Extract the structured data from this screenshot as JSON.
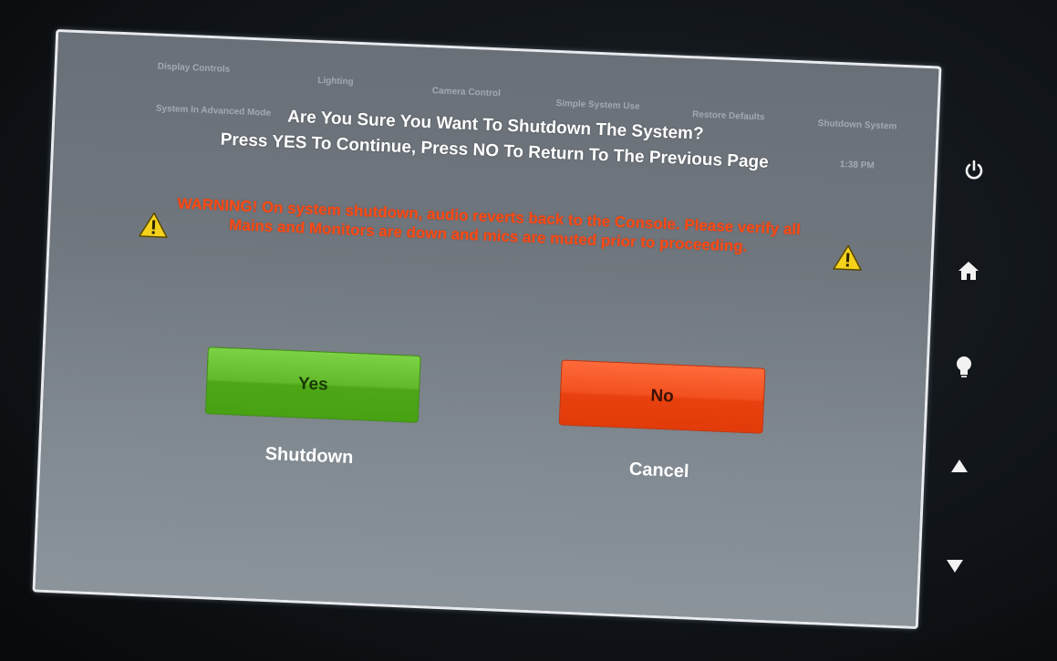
{
  "nav": {
    "display_controls": "Display Controls",
    "lighting": "Lighting",
    "camera_control": "Camera Control",
    "simple_system_use": "Simple System Use",
    "restore_defaults": "Restore Defaults",
    "shutdown_system": "Shutdown System",
    "system_advanced_mode": "System In Advanced Mode",
    "clock": "1:38 PM"
  },
  "dialog": {
    "title": "Are You Sure You Want To Shutdown The System?",
    "subtitle": "Press YES To Continue, Press NO To Return To The Previous Page",
    "warning": "WARNING!  On system shutdown, audio reverts back to the Console. Please verify all Mains and Monitors are down and mics are muted prior to proceeding.",
    "yes_label": "Yes",
    "yes_caption": "Shutdown",
    "no_label": "No",
    "no_caption": "Cancel"
  },
  "colors": {
    "yes": "#5fb626",
    "no": "#f04d1d",
    "warning_text": "#ff4a12",
    "warning_icon": "#f5d21c"
  },
  "side_buttons": [
    "power-icon",
    "home-icon",
    "lightbulb-icon",
    "arrow-up-icon",
    "arrow-down-icon"
  ]
}
